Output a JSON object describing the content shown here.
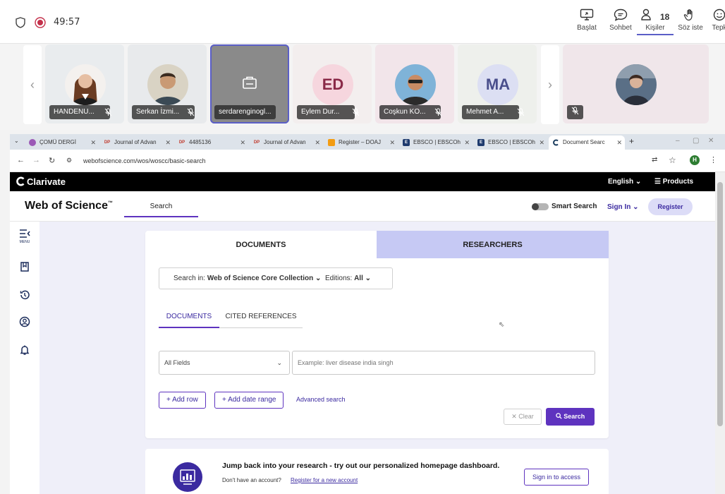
{
  "teams": {
    "timer": "49:57",
    "actions": [
      {
        "label": "Başlat",
        "icon": "share-screen-icon"
      },
      {
        "label": "Sohbet",
        "icon": "chat-icon"
      },
      {
        "label": "Kişiler",
        "icon": "people-icon"
      },
      {
        "label": "Söz iste",
        "icon": "raise-hand-icon"
      },
      {
        "label": "Tepk",
        "icon": "reaction-icon"
      }
    ],
    "people_count": "18",
    "participants": [
      {
        "name": "HANDENU...",
        "type": "photo"
      },
      {
        "name": "Serkan İzmi...",
        "type": "photo"
      },
      {
        "name": "serdarenginogl...",
        "type": "screen-share"
      },
      {
        "name": "Eylem Dur...",
        "type": "initials",
        "initials": "ED"
      },
      {
        "name": "Coşkun KO...",
        "type": "photo"
      },
      {
        "name": "Mehmet A...",
        "type": "initials",
        "initials": "MA"
      },
      {
        "name": "",
        "type": "photo"
      }
    ],
    "prev_arrow": "‹",
    "next_arrow": "›"
  },
  "browser": {
    "tabs": [
      {
        "title": "ÇOMÜ DERGİ",
        "icon": ""
      },
      {
        "title": "Journal of Advan",
        "icon": "DP"
      },
      {
        "title": "4485136",
        "icon": "DP"
      },
      {
        "title": "Journal of Advan",
        "icon": "DP"
      },
      {
        "title": "Register – DOAJ",
        "icon": ""
      },
      {
        "title": "EBSCO | EBSCOh",
        "icon": "E"
      },
      {
        "title": "EBSCO | EBSCOh",
        "icon": "E"
      },
      {
        "title": "Document Searc",
        "icon": ""
      }
    ],
    "new_tab": "+",
    "url": "webofscience.com/wos/woscc/basic-search",
    "profile_initial": "H"
  },
  "clarivate": {
    "brand": "Clarivate",
    "language": "English",
    "products": "Products"
  },
  "wos": {
    "logo": "Web of Science",
    "logo_tm": "™",
    "nav_search": "Search",
    "smart_search": "Smart Search",
    "sign_in": "Sign In",
    "register": "Register",
    "menu_label": "MENU"
  },
  "search": {
    "tab_documents": "DOCUMENTS",
    "tab_researchers": "RESEARCHERS",
    "search_in_label": "Search in:",
    "search_in_value": "Web of Science Core Collection",
    "editions_label": "Editions:",
    "editions_value": "All",
    "subtab_documents": "DOCUMENTS",
    "subtab_cited": "CITED REFERENCES",
    "field_select": "All Fields",
    "query_placeholder": "Example: liver disease india singh",
    "add_row": "+ Add row",
    "add_date_range": "+ Add date range",
    "advanced_search": "Advanced search",
    "clear": "Clear",
    "search_button": "Search"
  },
  "dashboard": {
    "headline": "Jump back into your research - try out our personalized homepage dashboard.",
    "no_account": "Don't have an account?",
    "register_link": "Register for a new account",
    "sign_in_button": "Sign in to access"
  },
  "colors": {
    "teams_accent": "#5b5fc7",
    "wos_purple": "#5e33bf",
    "researchers_tab": "#c6c9f4",
    "clarivate_bar": "#000000"
  }
}
